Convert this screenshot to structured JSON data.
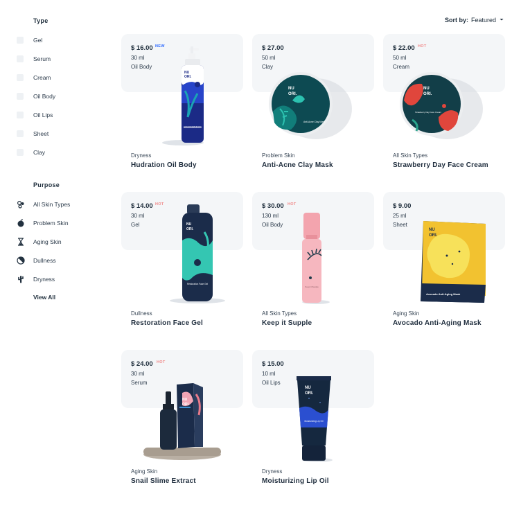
{
  "sidebar": {
    "type_heading": "Type",
    "types": [
      "Gel",
      "Serum",
      "Cream",
      "Oil Body",
      "Oil Lips",
      "Sheet",
      "Clay"
    ],
    "purpose_heading": "Purpose",
    "purposes": [
      {
        "label": "All Skin Types",
        "icon": "bubbles-icon"
      },
      {
        "label": "Problem Skin",
        "icon": "apple-icon"
      },
      {
        "label": "Aging Skin",
        "icon": "hourglass-icon"
      },
      {
        "label": "Dullness",
        "icon": "half-circle-icon"
      },
      {
        "label": "Dryness",
        "icon": "cactus-icon"
      }
    ],
    "view_all": "View All"
  },
  "sort": {
    "label": "Sort by:",
    "value": "Featured"
  },
  "brand": {
    "l1": "NU",
    "l2": "ORI."
  },
  "colors": {
    "new": "#2f6bff",
    "hot": "#f08b8b",
    "panel": "#f4f6f8",
    "text": "#1f2d3d"
  },
  "products": [
    {
      "price": "$ 16.00",
      "badge": "NEW",
      "volume": "30 ml",
      "type": "Oil Body",
      "category": "Dryness",
      "name": "Hudration Oil Body",
      "tag": "Hudration Oil Body"
    },
    {
      "price": "$ 27.00",
      "badge": "",
      "volume": "50 ml",
      "type": "Clay",
      "category": "Problem Skin",
      "name": "Anti-Acne Clay Mask",
      "tag": "Anti-Acne Clay Mask"
    },
    {
      "price": "$ 22.00",
      "badge": "HOT",
      "volume": "50 ml",
      "type": "Cream",
      "category": "All Skin Types",
      "name": "Strawberry Day Face Cream",
      "tag": "Strawberry Day Face Cream"
    },
    {
      "price": "$ 14.00",
      "badge": "HOT",
      "volume": "30 ml",
      "type": "Gel",
      "category": "Dullness",
      "name": "Restoration Face Gel",
      "tag": "Restoration Face Gel"
    },
    {
      "price": "$ 30.00",
      "badge": "HOT",
      "volume": "130 ml",
      "type": "Oil Body",
      "category": "All Skin Types",
      "name": "Keep it Supple",
      "tag": "Keep it Supple"
    },
    {
      "price": "$ 9.00",
      "badge": "",
      "volume": "25 ml",
      "type": "Sheet",
      "category": "Aging Skin",
      "name": "Avocado Anti-Aging Mask",
      "tag": "Avocado Anti-Aging Mask"
    },
    {
      "price": "$ 24.00",
      "badge": "HOT",
      "volume": "30 ml",
      "type": "Serum",
      "category": "Aging Skin",
      "name": "Snail Slime Extract",
      "tag": "Snail Slime Extract"
    },
    {
      "price": "$ 15.00",
      "badge": "",
      "volume": "10 ml",
      "type": "Oil Lips",
      "category": "Dryness",
      "name": "Moisturizing Lip Oil",
      "tag": "Moisturizing Lip Oil"
    }
  ]
}
